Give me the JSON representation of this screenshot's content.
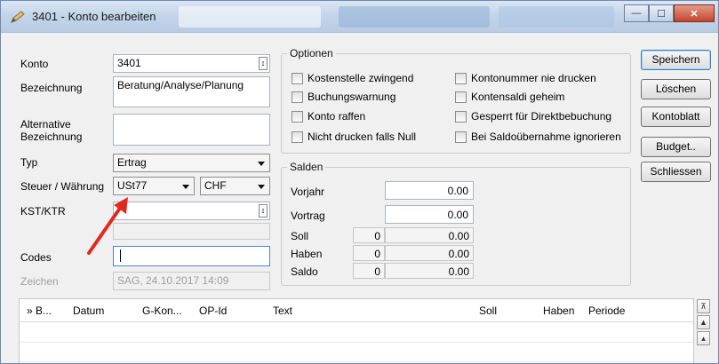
{
  "window": {
    "title": "3401 - Konto bearbeiten"
  },
  "colors": {
    "arrow": "#e02a20",
    "titlebar": "#c4d5ea",
    "close": "#c3452c"
  },
  "form": {
    "konto_label": "Konto",
    "konto_value": "3401",
    "bezeichnung_label": "Bezeichnung",
    "bezeichnung_value": "Beratung/Analyse/Planung",
    "alt_label_1": "Alternative",
    "alt_label_2": "Bezeichnung",
    "alt_value": "",
    "typ_label": "Typ",
    "typ_value": "Ertrag",
    "steuer_label": "Steuer / Währung",
    "steuer_value": "USt77",
    "waehrung_value": "CHF",
    "kst_label": "KST/KTR",
    "kst_value": "",
    "codes_label": "Codes",
    "codes_value": "",
    "zeichen_label": "Zeichen",
    "zeichen_value": "SAG, 24.10.2017 14:09"
  },
  "optionen": {
    "legend": "Optionen",
    "left": [
      "Kostenstelle zwingend",
      "Buchungswarnung",
      "Konto raffen",
      "Nicht drucken falls Null"
    ],
    "right": [
      "Kontonummer nie drucken",
      "Kontensaldi geheim",
      "Gesperrt für Direktbebuchung",
      "Bei Saldoübernahme ignorieren"
    ]
  },
  "salden": {
    "legend": "Salden",
    "vorjahr_label": "Vorjahr",
    "vorjahr_value": "0.00",
    "vortrag_label": "Vortrag",
    "vortrag_value": "0.00",
    "soll_label": "Soll",
    "soll_count": "0",
    "soll_value": "0.00",
    "haben_label": "Haben",
    "haben_count": "0",
    "haben_value": "0.00",
    "saldo_label": "Saldo",
    "saldo_count": "0",
    "saldo_value": "0.00"
  },
  "buttons": {
    "speichern": "Speichern",
    "loeschen": "Löschen",
    "kontoblatt": "Kontoblatt",
    "budget": "Budget..",
    "schliessen": "Schliessen"
  },
  "grid": {
    "columns": [
      "» B...",
      "Datum",
      "G-Kon...",
      "OP-Id",
      "Text",
      "Soll",
      "Haben",
      "Periode"
    ]
  }
}
